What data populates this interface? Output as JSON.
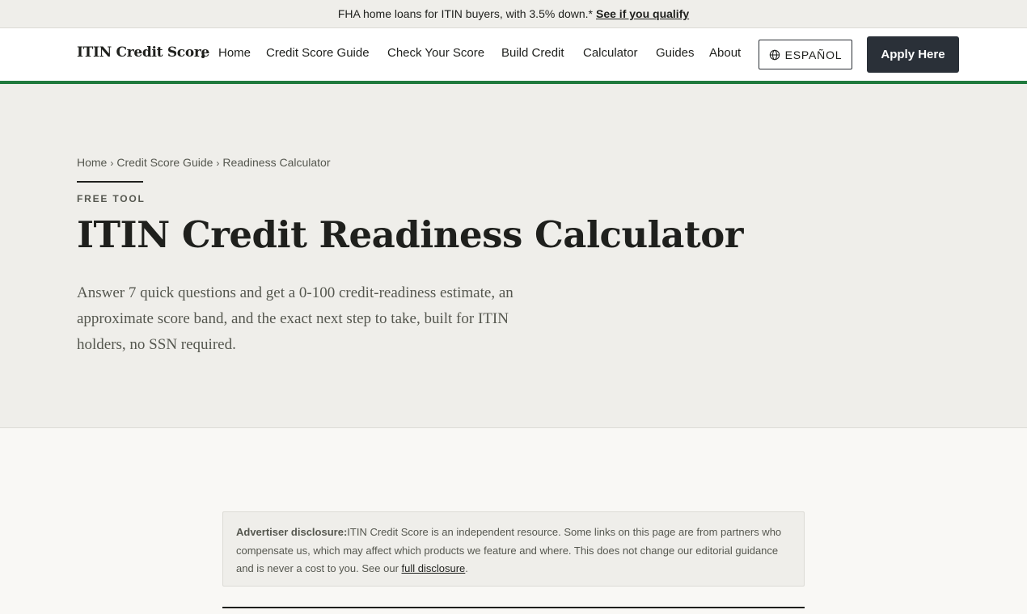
{
  "promo": {
    "text": "FHA home loans for ITIN buyers, with 3.5% down.*",
    "link": "See if you qualify"
  },
  "header": {
    "logo": "ITIN Credit Score",
    "nav": [
      "Home",
      "Credit Score Guide",
      "Check Your Score",
      "Build Credit",
      "Calculator",
      "Guides",
      "About"
    ],
    "language_button": "ESPAÑOL",
    "apply_button": "Apply Here"
  },
  "breadcrumb": [
    "Home",
    "Credit Score Guide",
    "Readiness Calculator"
  ],
  "hero": {
    "eyebrow": "FREE TOOL",
    "title": "ITIN Credit Readiness Calculator",
    "lede": "Answer 7 quick questions and get a 0-100 credit-readiness estimate, an approximate score band, and the exact next step to take, built for ITIN holders, no SSN required."
  },
  "disclosure": {
    "label": "Advertiser disclosure:",
    "text": "ITIN Credit Score is an independent resource. Some links on this page are from partners who compensate us, which may affect which products we feature and where. This does not change our editorial guidance and is never a cost to you. See our",
    "link": "full disclosure",
    "end": "."
  },
  "colors": {
    "accent": "#1f7a3d",
    "button_dark": "#2a3038",
    "hero_bg": "#efeeea"
  },
  "icons": {
    "language": "globe-icon"
  }
}
